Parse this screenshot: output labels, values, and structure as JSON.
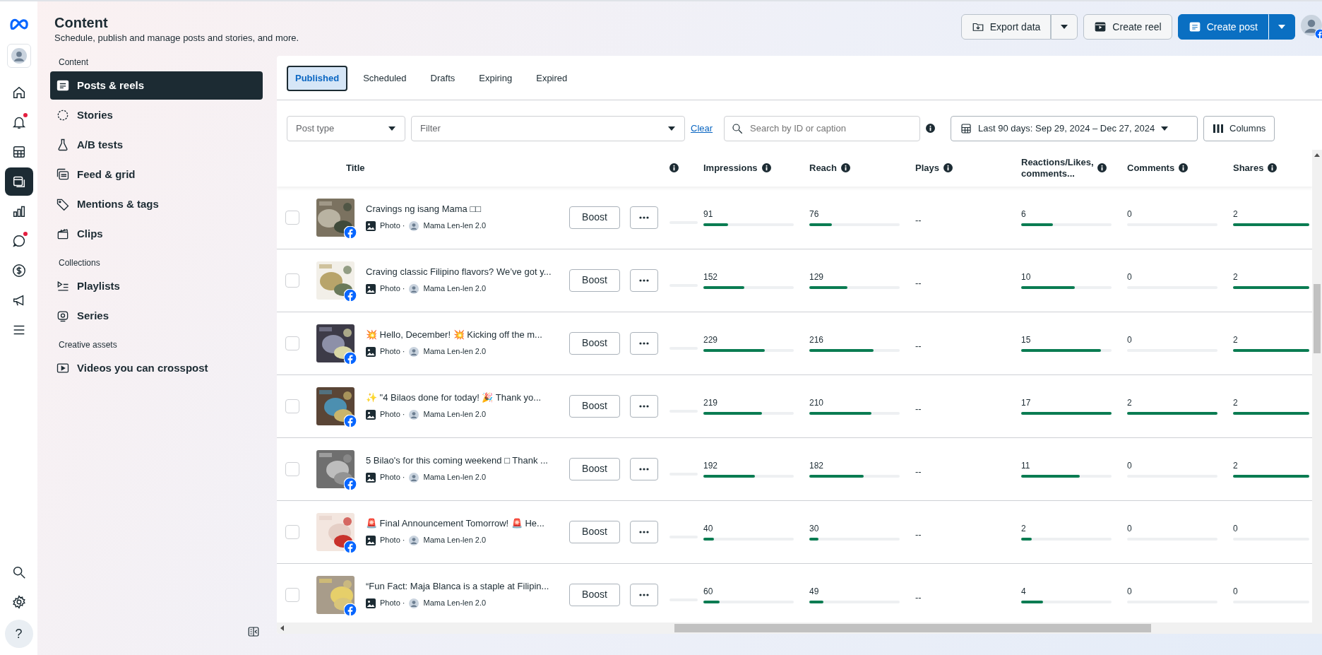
{
  "rail": {
    "items": [
      {
        "kind": "home",
        "selected": false,
        "dot": false
      },
      {
        "kind": "bell",
        "selected": false,
        "dot": true
      },
      {
        "kind": "grid",
        "selected": false,
        "dot": false
      },
      {
        "kind": "content",
        "selected": true,
        "dot": false
      },
      {
        "kind": "chart",
        "selected": false,
        "dot": false
      },
      {
        "kind": "chat",
        "selected": false,
        "dot": true
      },
      {
        "kind": "dollar",
        "selected": false,
        "dot": false
      },
      {
        "kind": "megaphone",
        "selected": false,
        "dot": false
      },
      {
        "kind": "menu",
        "selected": false,
        "dot": false
      }
    ],
    "bottom": [
      {
        "kind": "search"
      },
      {
        "kind": "settings"
      },
      {
        "kind": "help",
        "text": "?"
      }
    ]
  },
  "header": {
    "title": "Content",
    "subtitle": "Schedule, publish and manage posts and stories, and more.",
    "actions": [
      {
        "kind": "export",
        "label": "Export data",
        "split": true,
        "primary": false
      },
      {
        "kind": "reel",
        "label": "Create reel",
        "split": false,
        "primary": false
      },
      {
        "kind": "post",
        "label": "Create post",
        "split": true,
        "primary": true
      }
    ]
  },
  "sidebar": {
    "sections": [
      {
        "heading": "Content",
        "items": [
          {
            "kind": "posts",
            "label": "Posts & reels",
            "selected": true
          },
          {
            "kind": "stories",
            "label": "Stories",
            "selected": false
          },
          {
            "kind": "flask",
            "label": "A/B tests",
            "selected": false
          },
          {
            "kind": "feed",
            "label": "Feed & grid",
            "selected": false
          },
          {
            "kind": "tag",
            "label": "Mentions & tags",
            "selected": false
          },
          {
            "kind": "clips",
            "label": "Clips",
            "selected": false
          }
        ]
      },
      {
        "heading": "Collections",
        "items": [
          {
            "kind": "playlist",
            "label": "Playlists",
            "selected": false
          },
          {
            "kind": "series",
            "label": "Series",
            "selected": false
          }
        ]
      },
      {
        "heading": "Creative assets",
        "items": [
          {
            "kind": "video",
            "label": "Videos you can crosspost",
            "selected": false
          }
        ]
      }
    ]
  },
  "tabs": [
    {
      "label": "Published",
      "selected": true
    },
    {
      "label": "Scheduled",
      "selected": false
    },
    {
      "label": "Drafts",
      "selected": false
    },
    {
      "label": "Expiring",
      "selected": false
    },
    {
      "label": "Expired",
      "selected": false
    }
  ],
  "filters": {
    "post_type": {
      "placeholder": "Post type"
    },
    "filter": {
      "placeholder": "Filter"
    },
    "clear": "Clear",
    "search": {
      "placeholder": "Search by ID or caption"
    },
    "date_range": "Last 90 days: Sep 29, 2024 – Dec 27, 2024",
    "columns_button": "Columns"
  },
  "table": {
    "columns": [
      "Title",
      "Impressions",
      "Reach",
      "Plays",
      "Reactions/Likes, comments...",
      "Comments",
      "Shares"
    ],
    "rows": [
      {
        "checked": false,
        "caption": "Cravings ng isang Mama □□",
        "type": "Photo ·",
        "page": "Mama Len-len 2.0",
        "boost": "Boost",
        "metrics": [
          {
            "value": "91",
            "level": 0.27
          },
          {
            "value": "76",
            "level": 0.25
          },
          {
            "value": "--"
          },
          {
            "value": "6",
            "level": 0.35
          },
          {
            "value": "0",
            "level": 0
          },
          {
            "value": "2",
            "level": 1
          }
        ]
      },
      {
        "checked": false,
        "caption": "Craving classic Filipino flavors? We’ve got y...",
        "type": "Photo ·",
        "page": "Mama Len-len 2.0",
        "boost": "Boost",
        "metrics": [
          {
            "value": "152",
            "level": 0.45
          },
          {
            "value": "129",
            "level": 0.42
          },
          {
            "value": "--"
          },
          {
            "value": "10",
            "level": 0.59
          },
          {
            "value": "0",
            "level": 0
          },
          {
            "value": "2",
            "level": 1
          }
        ]
      },
      {
        "checked": false,
        "caption": "💥 Hello, December! 💥 Kicking off the m...",
        "type": "Photo ·",
        "page": "Mama Len-len 2.0",
        "boost": "Boost",
        "metrics": [
          {
            "value": "229",
            "level": 0.68
          },
          {
            "value": "216",
            "level": 0.71
          },
          {
            "value": "--"
          },
          {
            "value": "15",
            "level": 0.88
          },
          {
            "value": "0",
            "level": 0
          },
          {
            "value": "2",
            "level": 1
          }
        ]
      },
      {
        "checked": false,
        "caption": "✨ \"4 Bilaos done for today! 🎉 Thank yo...",
        "type": "Photo ·",
        "page": "Mama Len-len 2.0",
        "boost": "Boost",
        "metrics": [
          {
            "value": "219",
            "level": 0.65
          },
          {
            "value": "210",
            "level": 0.69
          },
          {
            "value": "--"
          },
          {
            "value": "17",
            "level": 1
          },
          {
            "value": "2",
            "level": 1
          },
          {
            "value": "2",
            "level": 1
          }
        ]
      },
      {
        "checked": false,
        "caption": "5 Bilao's for this coming weekend □ Thank ...",
        "type": "Photo ·",
        "page": "Mama Len-len 2.0",
        "boost": "Boost",
        "metrics": [
          {
            "value": "192",
            "level": 0.57
          },
          {
            "value": "182",
            "level": 0.6
          },
          {
            "value": "--"
          },
          {
            "value": "11",
            "level": 0.65
          },
          {
            "value": "0",
            "level": 0
          },
          {
            "value": "2",
            "level": 1
          }
        ]
      },
      {
        "checked": false,
        "caption": "🚨 Final Announcement Tomorrow! 🚨 He...",
        "type": "Photo ·",
        "page": "Mama Len-len 2.0",
        "boost": "Boost",
        "metrics": [
          {
            "value": "40",
            "level": 0.12
          },
          {
            "value": "30",
            "level": 0.1
          },
          {
            "value": "--"
          },
          {
            "value": "2",
            "level": 0.12
          },
          {
            "value": "0",
            "level": 0
          },
          {
            "value": "0",
            "level": 0
          }
        ]
      },
      {
        "checked": false,
        "caption": "“Fun Fact: Maja Blanca is a staple at Filipin...",
        "type": "Photo ·",
        "page": "Mama Len-len 2.0",
        "boost": "Boost",
        "metrics": [
          {
            "value": "60",
            "level": 0.18
          },
          {
            "value": "49",
            "level": 0.16
          },
          {
            "value": "--"
          },
          {
            "value": "4",
            "level": 0.24
          },
          {
            "value": "0",
            "level": 0
          },
          {
            "value": "0",
            "level": 0
          }
        ]
      }
    ]
  }
}
